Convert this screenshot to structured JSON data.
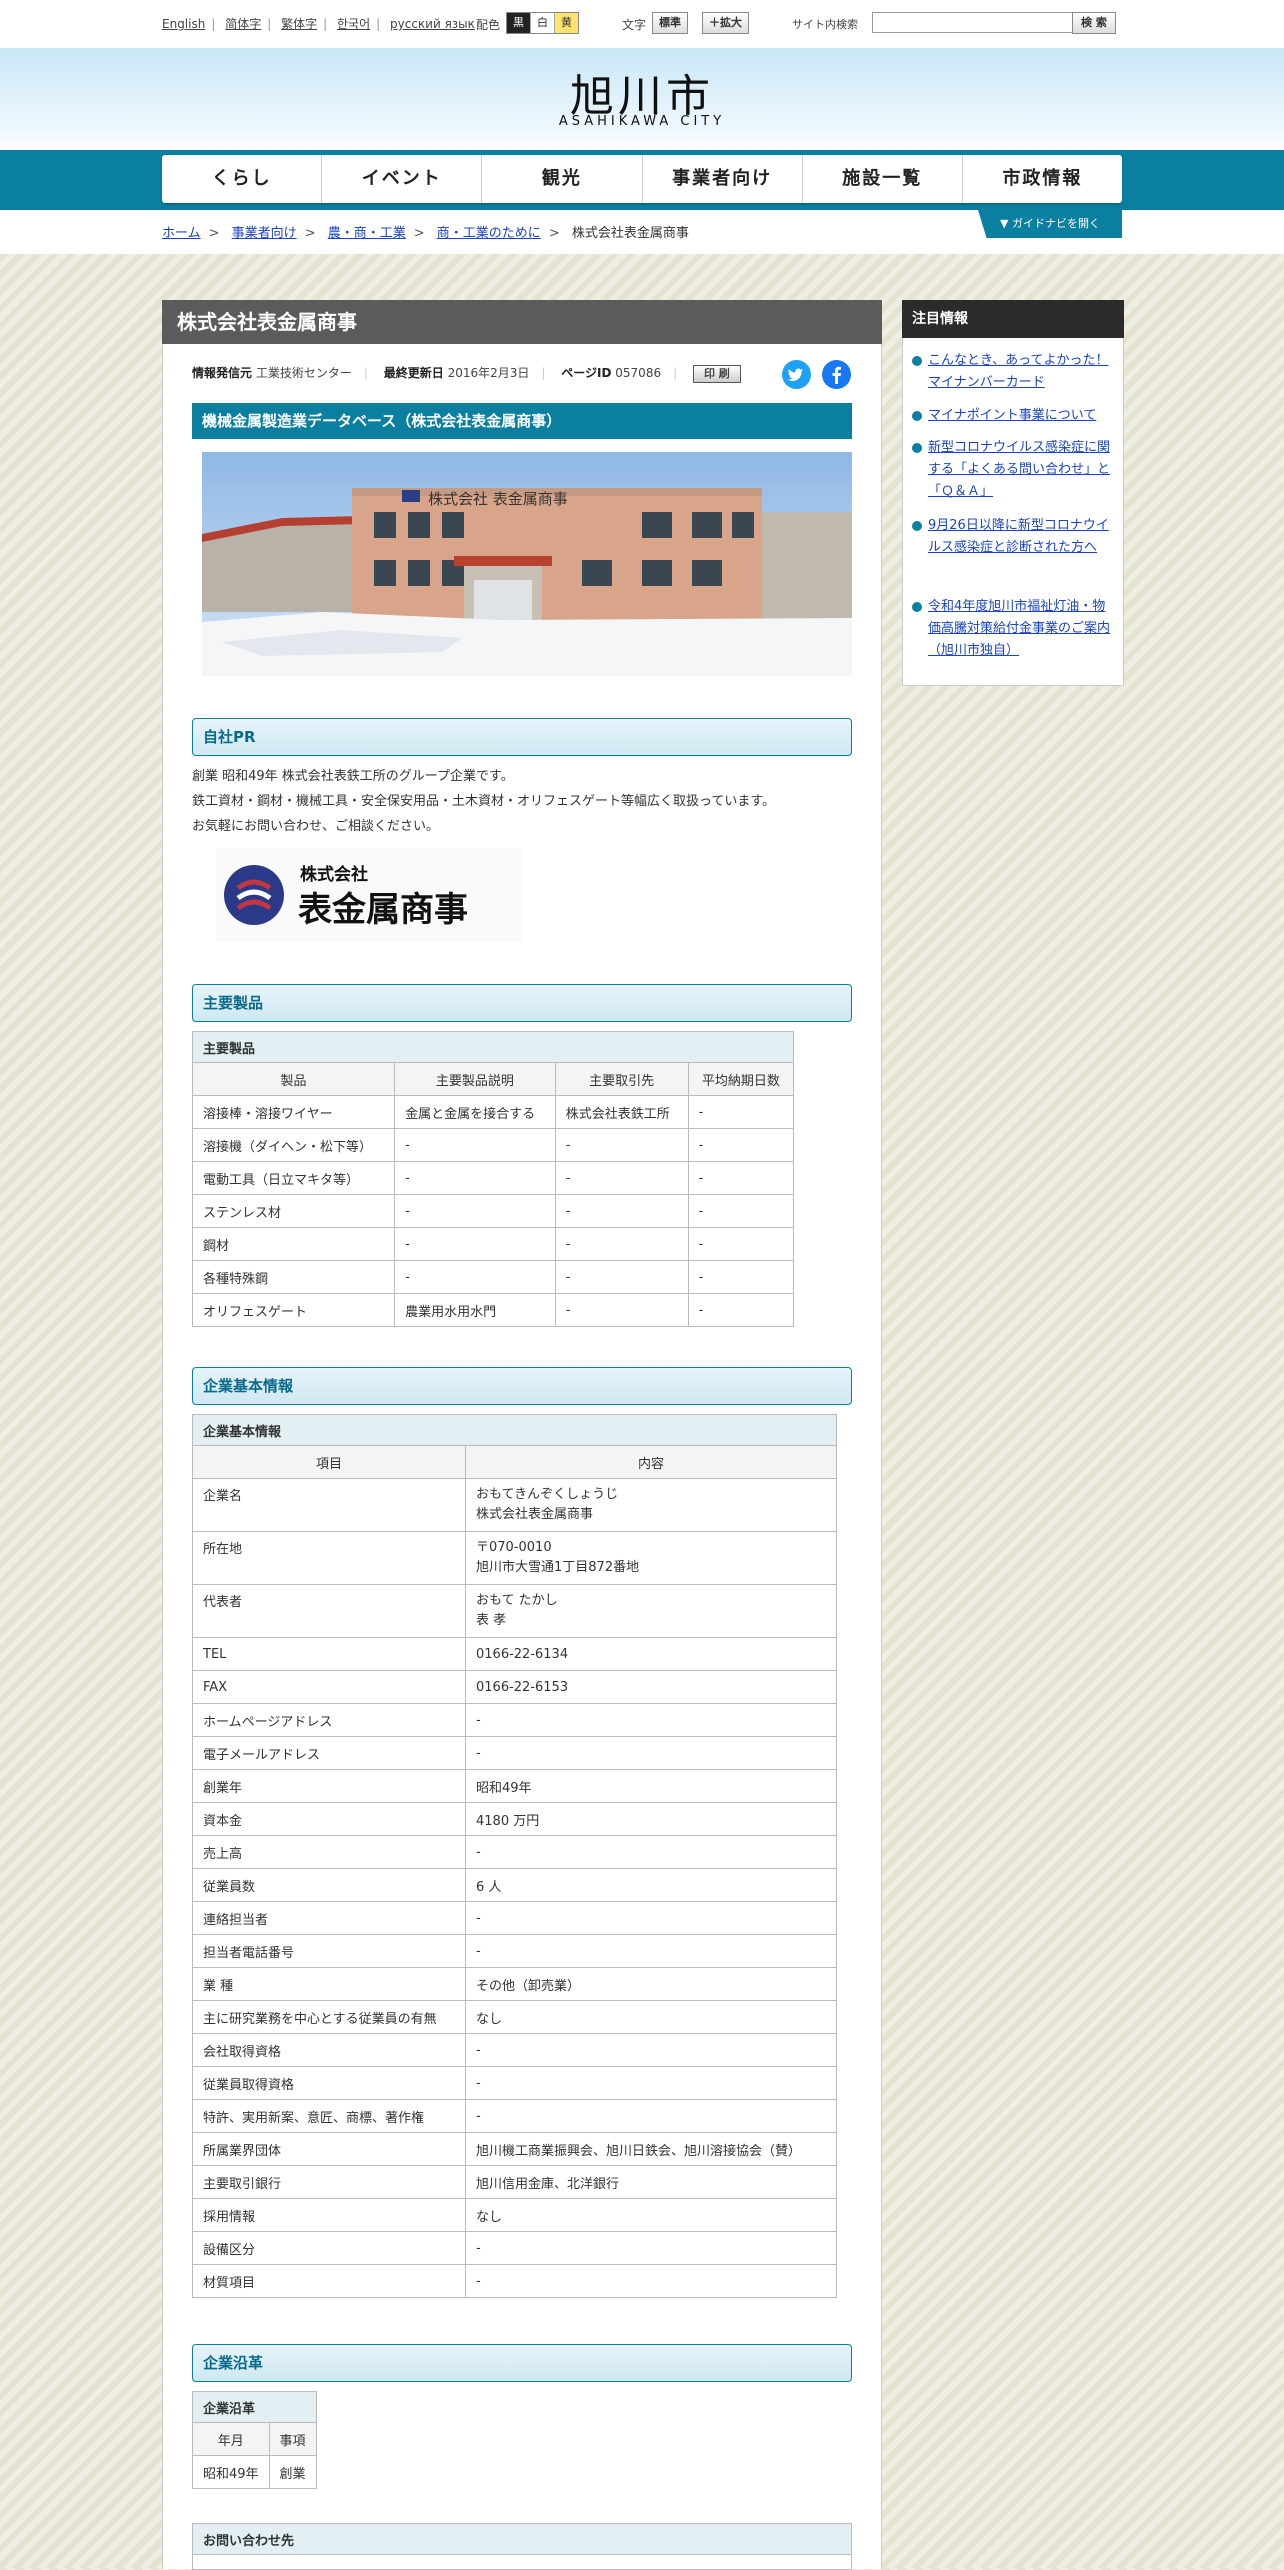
{
  "top": {
    "languages": [
      "English",
      "简体字",
      "繁体字",
      "한국어",
      "русский язык"
    ],
    "color_label": "配色",
    "colors": [
      "黒",
      "白",
      "黄"
    ],
    "text_label": "文字",
    "text_standard": "標準",
    "text_enlarge": "＋拡大",
    "search_label": "サイト内検索",
    "search_value": "",
    "search_button": "検 索"
  },
  "header": {
    "logo_ja": "旭川市",
    "logo_en": "ASAHIKAWA CITY"
  },
  "nav": [
    "くらし",
    "イベント",
    "観光",
    "事業者向け",
    "施設一覧",
    "市政情報"
  ],
  "breadcrumb": [
    "ホーム",
    "事業者向け",
    "農・商・工業",
    "商・工業のために",
    "株式会社表金属商事"
  ],
  "guide_label": "▼ ガイドナビを開く",
  "page": {
    "title": "株式会社表金属商事",
    "meta": {
      "source_label": "情報発信元",
      "source": "工業技術センター",
      "updated_label": "最終更新日",
      "updated": "2016年2月3日",
      "page_id_label": "ページID",
      "page_id": "057086",
      "print": "印 刷"
    },
    "section_title": "機械金属製造業データベース（株式会社表金属商事）",
    "building_sign": "株式会社 表金属商事",
    "pr": {
      "heading": "自社PR",
      "lines": [
        "創業 昭和49年 株式会社表鉄工所のグループ企業です。",
        "鉄工資材・鋼材・機械工具・安全保安用品・土木資材・オリフェスゲート等幅広く取扱っています。",
        "お気軽にお問い合わせ、ご相談ください。"
      ],
      "logo_small": "株式会社",
      "logo_big": "表金属商事"
    },
    "products": {
      "heading": "主要製品",
      "caption": "主要製品",
      "headers": [
        "製品",
        "主要製品説明",
        "主要取引先",
        "平均納期日数"
      ],
      "rows": [
        [
          "溶接棒・溶接ワイヤー",
          "金属と金属を接合する",
          "株式会社表鉄工所",
          "-"
        ],
        [
          "溶接機（ダイヘン・松下等）",
          "-",
          "-",
          "-"
        ],
        [
          "電動工具（日立マキタ等）",
          "-",
          "-",
          "-"
        ],
        [
          "ステンレス材",
          "-",
          "-",
          "-"
        ],
        [
          "鋼材",
          "-",
          "-",
          "-"
        ],
        [
          "各種特殊鋼",
          "-",
          "-",
          "-"
        ],
        [
          "オリフェスゲート",
          "農業用水用水門",
          "-",
          "-"
        ]
      ]
    },
    "company": {
      "heading": "企業基本情報",
      "caption": "企業基本情報",
      "headers": [
        "項目",
        "内容"
      ],
      "rows": [
        [
          "企業名",
          "おもてきんぞくしょうじ",
          "株式会社表金属商事"
        ],
        [
          "所在地",
          "〒070-0010",
          "旭川市大雪通1丁目872番地"
        ],
        [
          "代表者",
          "おもて たかし",
          "表 孝"
        ],
        [
          "TEL",
          "0166-22-6134"
        ],
        [
          "FAX",
          "0166-22-6153"
        ],
        [
          "ホームページアドレス",
          "-"
        ],
        [
          "電子メールアドレス",
          "-"
        ],
        [
          "創業年",
          "昭和49年"
        ],
        [
          "資本金",
          "4180 万円"
        ],
        [
          "売上高",
          "-"
        ],
        [
          "従業員数",
          "6 人"
        ],
        [
          "連絡担当者",
          "-"
        ],
        [
          "担当者電話番号",
          "-"
        ],
        [
          "業 種",
          "その他（卸売業）"
        ],
        [
          "主に研究業務を中心とする従業員の有無",
          "なし"
        ],
        [
          "会社取得資格",
          "-"
        ],
        [
          "従業員取得資格",
          "-"
        ],
        [
          "特許、実用新案、意匠、商標、著作権",
          "-"
        ],
        [
          "所属業界団体",
          "旭川機工商業振興会、旭川日鉄会、旭川溶接協会（賛）"
        ],
        [
          "主要取引銀行",
          "旭川信用金庫、北洋銀行"
        ],
        [
          "採用情報",
          "なし"
        ],
        [
          "設備区分",
          "-"
        ],
        [
          "材質項目",
          "-"
        ]
      ]
    },
    "history": {
      "heading": "企業沿革",
      "caption": "企業沿革",
      "headers": [
        "年月",
        "事項"
      ],
      "rows": [
        [
          "昭和49年",
          "創業"
        ]
      ]
    },
    "contact_caption": "お問い合わせ先"
  },
  "sidebar": {
    "title": "注目情報",
    "items": [
      "こんなとき、あってよかった！マイナンバーカード",
      "マイナポイント事業について",
      "新型コロナウイルス感染症に関する「よくある問い合わせ」と「Ｑ＆Ａ」",
      "9月26日以降に新型コロナウイルス感染症と診断された方へ",
      "令和4年度旭川市福祉灯油・物価高騰対策給付金事業のご案内（旭川市独自）"
    ]
  }
}
